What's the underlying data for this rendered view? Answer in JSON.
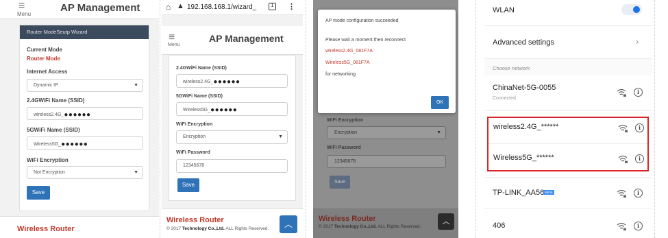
{
  "panel1": {
    "header": {
      "menu_label": "Menu",
      "title": "AP Management"
    },
    "wizard_title": "Router ModeSeutp Wizard",
    "current_mode_label": "Current Mode",
    "current_mode_value": "Router Mode",
    "internet_access_label": "Internet Access",
    "internet_access_value": "Dynamic IP",
    "ssid24_label": "2.4GWiFi Name (SSID)",
    "ssid24_prefix": "wireless2.4G_",
    "ssid24_mask": "●●●●●●",
    "ssid5_label": "5GWiFi Name (SSID)",
    "ssid5_prefix": "Wireless5G_",
    "ssid5_mask": "●●●●●●",
    "encryption_label": "WiFi Encryption",
    "encryption_value": "Not Encryption",
    "save_label": "Save",
    "footer_brand": "Wireless Router"
  },
  "panel2": {
    "browser": {
      "url": "192.168.168.1/wizard_",
      "tab_count": "1"
    },
    "header": {
      "menu_label": "Menu",
      "title": "AP Management"
    },
    "ssid24_label": "2.4GWiFi Name (SSID)",
    "ssid24_prefix": "wireless2.4G_",
    "ssid24_mask": "●●●●●●",
    "ssid5_label": "5GWiFi Name (SSID)",
    "ssid5_prefix": "Wireless5G_",
    "ssid5_mask": "●●●●●●",
    "encryption_label": "WiFi Encryption",
    "encryption_value": "Encryption",
    "password_label": "WiFi Password",
    "password_value": "12345678",
    "save_label": "Save",
    "footer_brand": "Wireless Router",
    "footer_copy_year": "© 2017",
    "footer_copy_company": "Technology Co.,Ltd.",
    "footer_copy_rights": "ALL Rights Reserved."
  },
  "panel3": {
    "dialog": {
      "message1": "AP mode configuration succeeded",
      "message2": "Please wait a moment then reconnect",
      "ssid1": "wireless2.4G_081F7A",
      "ssid2": "Wireless5G_081F7A",
      "message3": "for networking",
      "ok_label": "OK"
    },
    "encryption_label": "WiFi Encryption",
    "encryption_value": "Encryption",
    "password_label": "WiFi Password",
    "password_value": "12345678",
    "save_label": "Save",
    "footer_brand": "Wireless Router",
    "footer_copy_year": "© 2017",
    "footer_copy_company": "Technology Co.,Ltd.",
    "footer_copy_rights": "ALL Rights Reserved."
  },
  "panel4": {
    "wlan_label": "WLAN",
    "wlan_on": true,
    "advanced_label": "Advanced settings",
    "choose_label": "Choose network",
    "networks": [
      {
        "name": "ChinaNet-5G-0055",
        "status": "Connected"
      },
      {
        "name": "wireless2.4G_******"
      },
      {
        "name": "Wireless5G_******"
      },
      {
        "name": "TP-LINK_AA56",
        "badge": "WiFi6"
      },
      {
        "name": "406"
      }
    ],
    "highlight_color": "#d9262b"
  },
  "colors": {
    "accent": "#2e72b8",
    "brand_red": "#c0392b",
    "toggle": "#1a73e8"
  }
}
